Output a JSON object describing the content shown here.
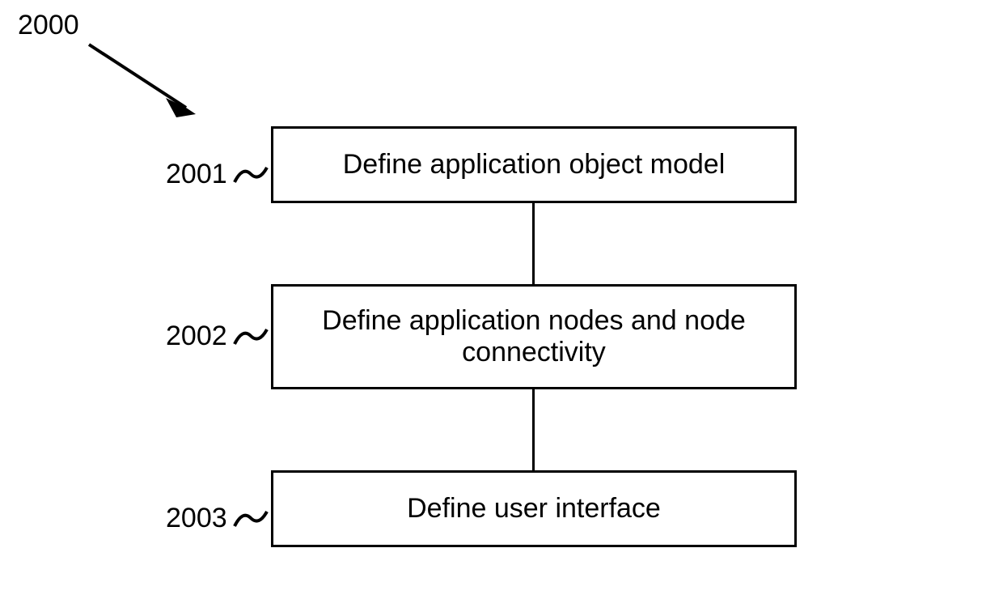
{
  "diagram": {
    "ref": "2000",
    "steps": [
      {
        "ref": "2001",
        "text": "Define application object model"
      },
      {
        "ref": "2002",
        "text": "Define application nodes and node connectivity"
      },
      {
        "ref": "2003",
        "text": "Define user interface"
      }
    ]
  }
}
